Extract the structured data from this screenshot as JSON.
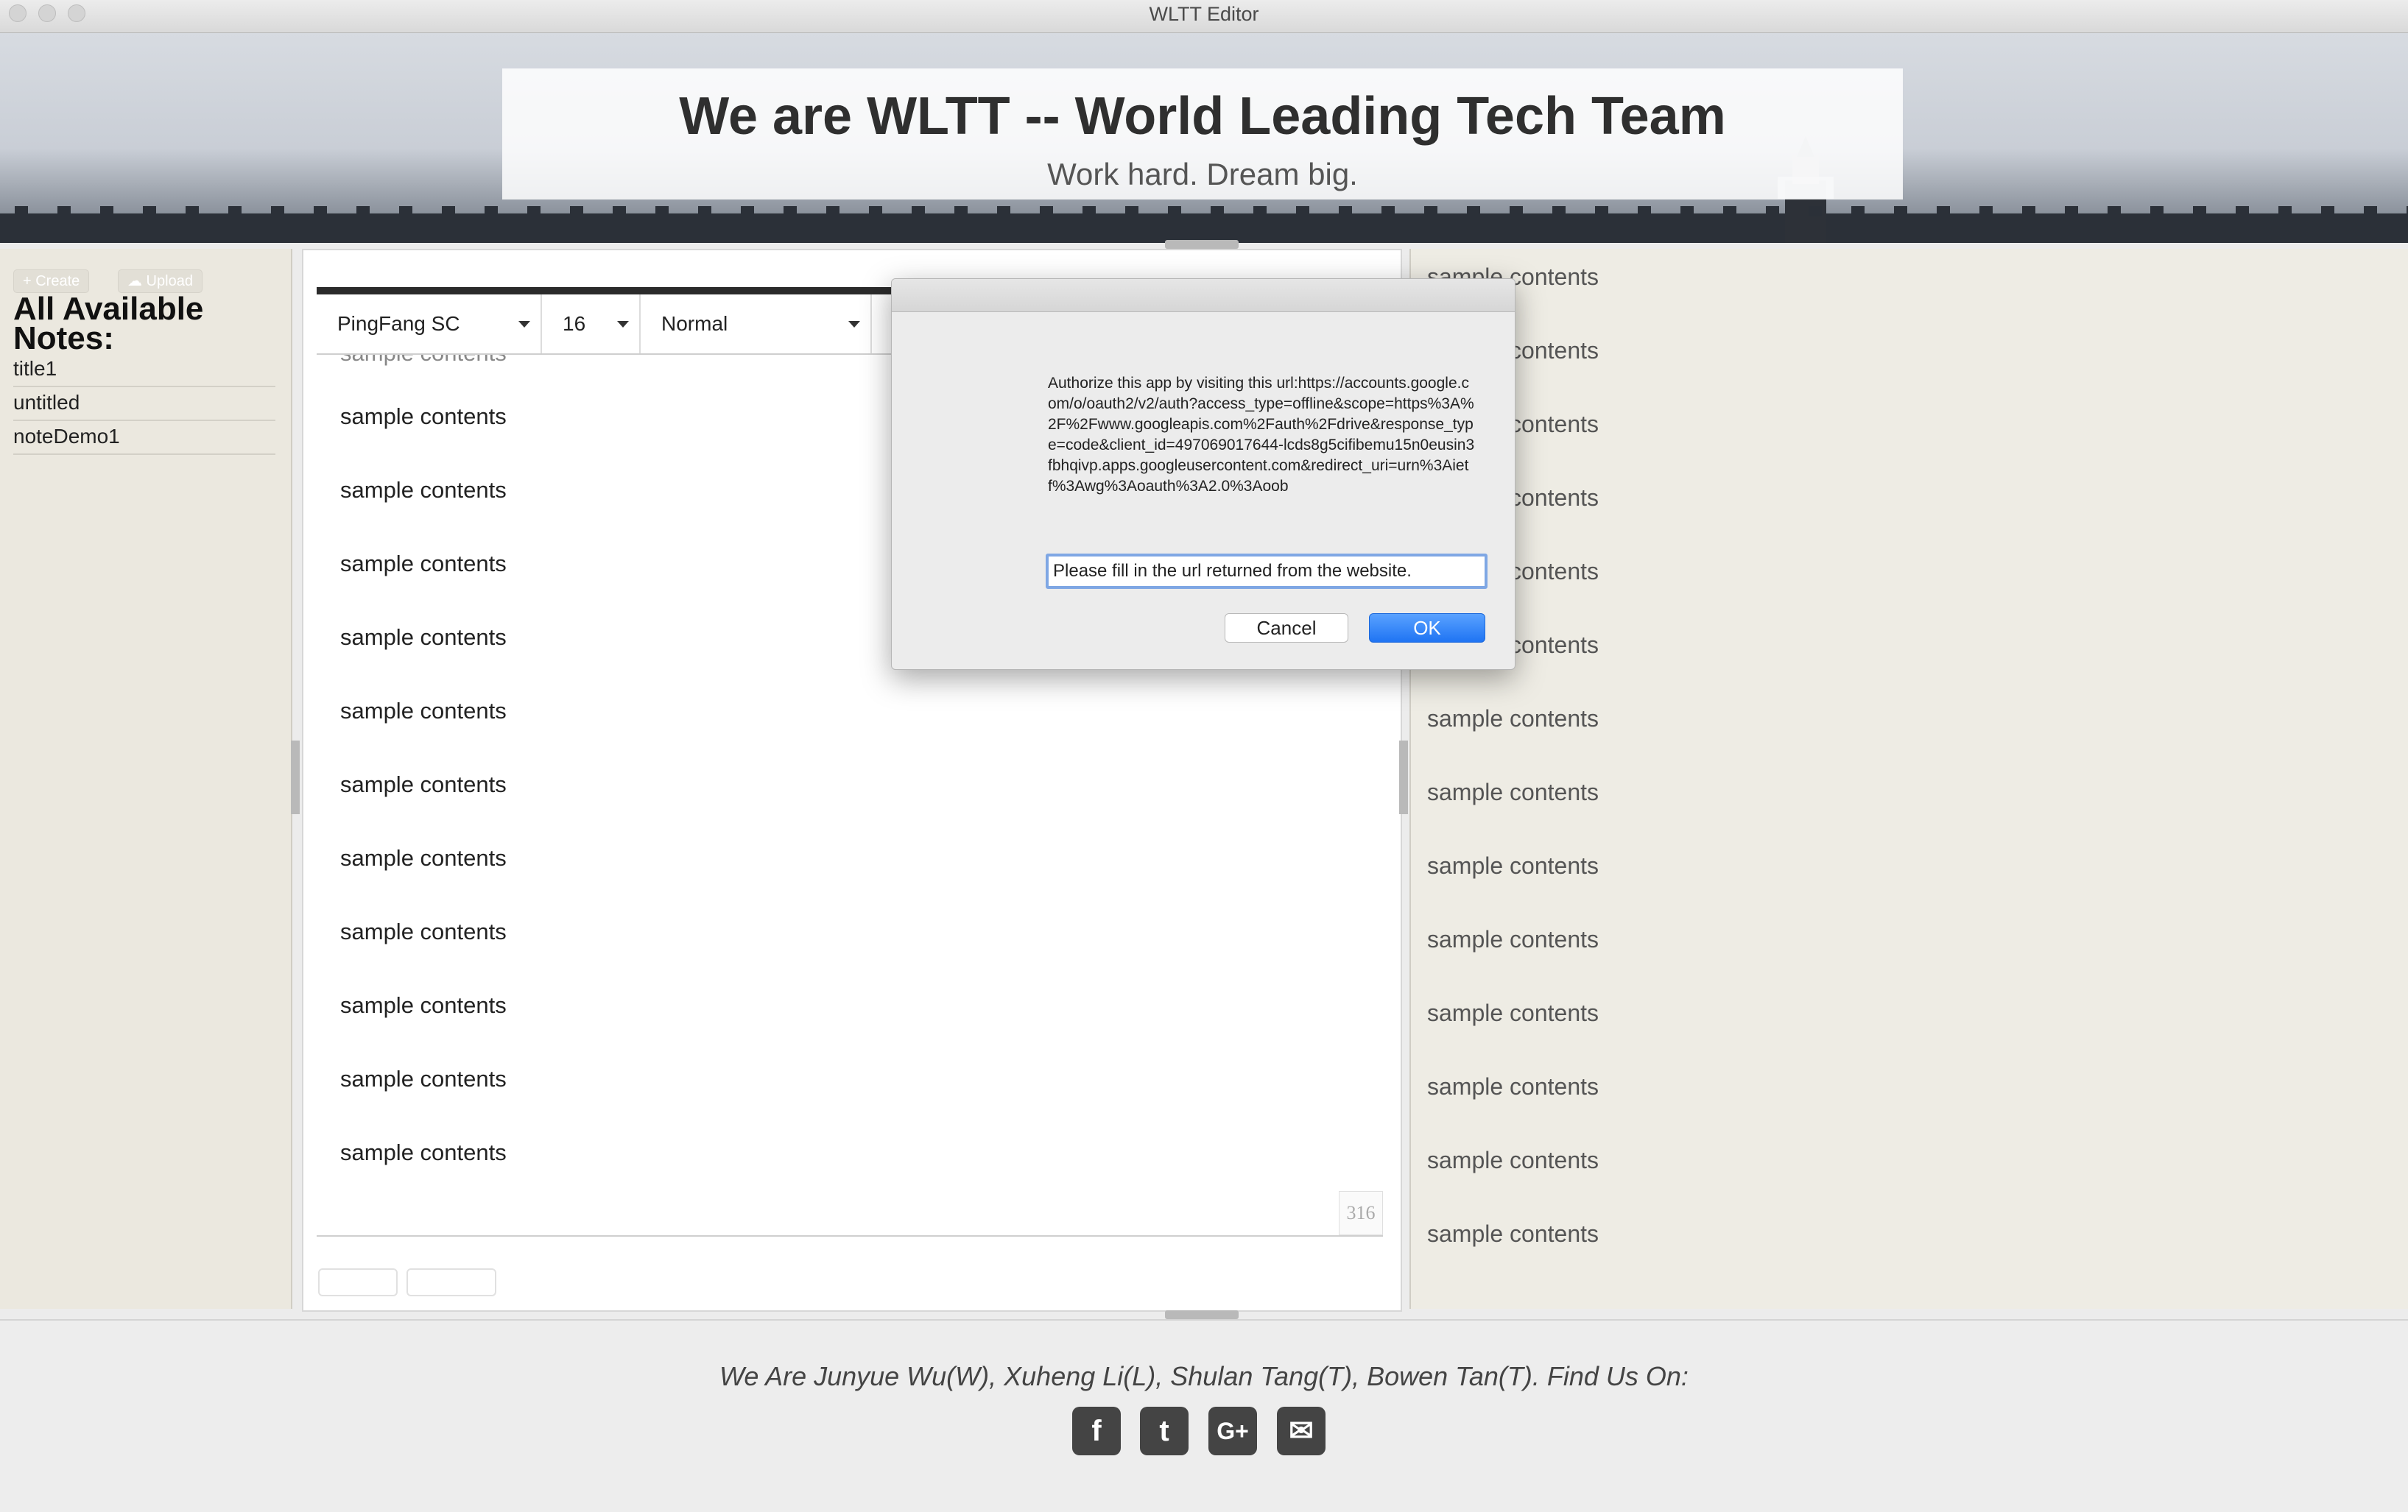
{
  "window": {
    "title": "WLTT Editor"
  },
  "header": {
    "title": "We are WLTT -- World Leading Tech Team",
    "subtitle": "Work hard. Dream big."
  },
  "sidebar": {
    "create_label": "+ Create",
    "upload_label": "☁ Upload",
    "heading": "All Available Notes:",
    "notes": [
      "title1",
      "untitled",
      "noteDemo1"
    ]
  },
  "editor": {
    "font_family": "PingFang SC",
    "font_size": "16",
    "block_style": "Normal",
    "lines": [
      "sample contents",
      "sample contents",
      "sample contents",
      "sample contents",
      "sample contents",
      "sample contents",
      "sample contents",
      "sample contents",
      "sample contents",
      "sample contents",
      "sample contents"
    ],
    "char_count": "316"
  },
  "preview": {
    "lines": [
      "sample contents",
      "sample contents",
      "sample contents",
      "sample contents",
      "sample contents",
      "sample contents",
      "sample contents",
      "sample contents",
      "sample contents",
      "sample contents",
      "sample contents",
      "sample contents",
      "sample contents",
      "sample contents"
    ]
  },
  "dialog": {
    "message": "Authorize this app by visiting this url:https://accounts.google.com/o/oauth2/v2/auth?access_type=offline&scope=https%3A%2F%2Fwww.googleapis.com%2Fauth%2Fdrive&response_type=code&client_id=497069017644-lcds8g5cifibemu15n0eusin3fbhqivp.apps.googleusercontent.com&redirect_uri=urn%3Aietf%3Awg%3Aoauth%3A2.0%3Aoob",
    "input_value": "Please fill in the url returned from the website.",
    "cancel_label": "Cancel",
    "ok_label": "OK"
  },
  "footer": {
    "text": "We Are Junyue Wu(W), Xuheng Li(L), Shulan Tang(T), Bowen Tan(T). Find Us On:",
    "social": [
      {
        "name": "facebook-icon",
        "glyph": "f"
      },
      {
        "name": "twitter-icon",
        "glyph": "t"
      },
      {
        "name": "google-plus-icon",
        "glyph": "G+"
      },
      {
        "name": "email-icon",
        "glyph": "✉"
      }
    ]
  },
  "colors": {
    "accent": "#1f74f3",
    "sidebar_bg": "#ebe8df",
    "preview_bg": "#eeece4"
  }
}
